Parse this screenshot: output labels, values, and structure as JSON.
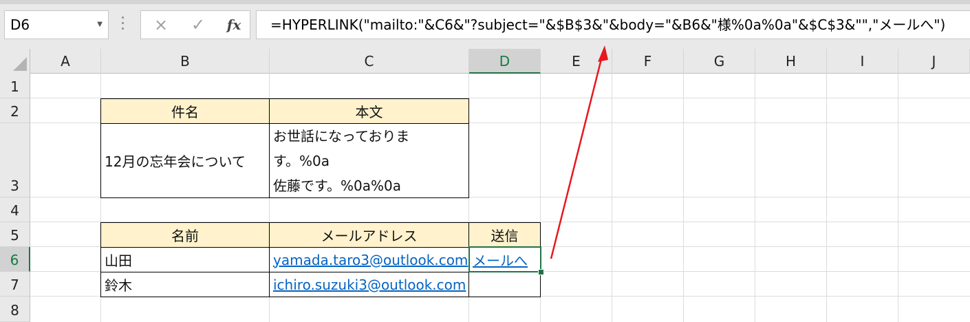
{
  "formula_bar": {
    "name_box": "D6",
    "cancel_icon": "×",
    "enter_icon": "✓",
    "fx_label": "fx",
    "formula": "=HYPERLINK(\"mailto:\"&C6&\"?subject=\"&$B$3&\"&body=\"&B6&\"様%0a%0a\"&$C$3&\"\",\"メールへ\")"
  },
  "columns": [
    "A",
    "B",
    "C",
    "D",
    "E",
    "F",
    "G",
    "H",
    "I",
    "J"
  ],
  "rows": [
    "1",
    "2",
    "3",
    "4",
    "5",
    "6",
    "7",
    "8"
  ],
  "selected_cell": "D6",
  "table1": {
    "headers": [
      "件名",
      "本文"
    ],
    "subject": "12月の忘年会について",
    "body_lines": [
      "お世話になっておりま",
      "す。%0a",
      "佐藤です。%0a%0a"
    ]
  },
  "table2": {
    "headers": [
      "名前",
      "メールアドレス",
      "送信"
    ],
    "rows": [
      {
        "name": "山田",
        "email": "yamada.taro3@outlook.com",
        "send": "メールへ"
      },
      {
        "name": "鈴木",
        "email": "ichiro.suzuki3@outlook.com",
        "send": ""
      }
    ]
  },
  "colors": {
    "header_fill": "#fff2cc",
    "link": "#0563c1",
    "selection": "#217346",
    "annotation_arrow": "#e8161e"
  }
}
